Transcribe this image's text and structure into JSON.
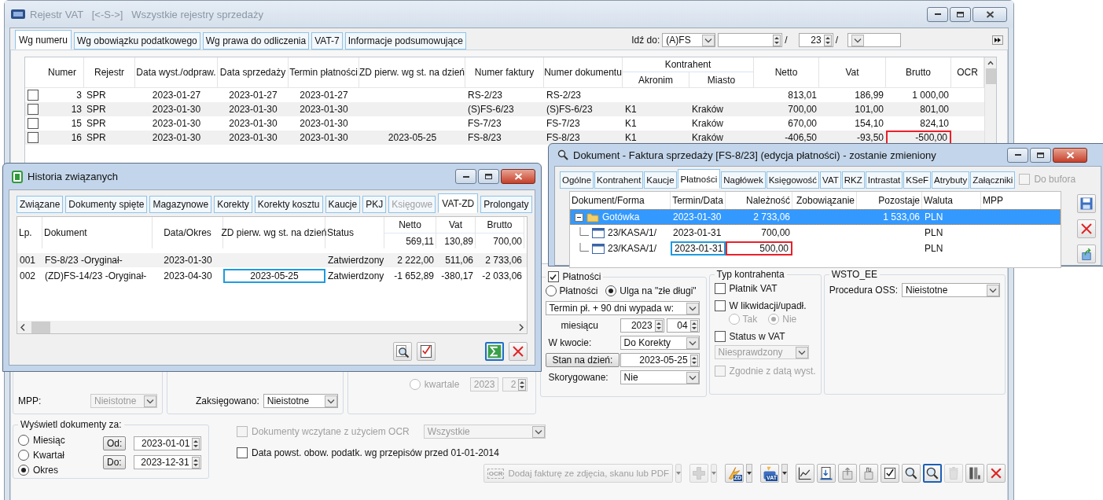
{
  "main_window": {
    "active": false,
    "title": "Rejestr VAT   [<-S->]   Wszystkie rejestry sprzedaży",
    "tabs": [
      {
        "label": "Wg numeru",
        "selected": true
      },
      {
        "label": "Wg obowiązku podatkowego",
        "selected": false
      },
      {
        "label": "Wg prawa do odliczenia",
        "selected": false
      },
      {
        "label": "VAT-7",
        "selected": false
      },
      {
        "label": "Informacje podsumowujące",
        "selected": false
      }
    ],
    "goto": {
      "label": "Idź do:",
      "series": "(A)FS",
      "separators": [
        "/",
        "/"
      ],
      "year": "23"
    },
    "table": {
      "columns": [
        "Numer",
        "Rejestr",
        "Data wyst./odpraw.",
        "Data sprzedaży",
        "Termin płatności",
        "ZD pierw. wg st. na dzień",
        "Numer faktury",
        "Numer dokumentu",
        "Akronim",
        "Miasto",
        "Netto",
        "Vat",
        "Brutto",
        "OCR"
      ],
      "group": "Kontrahent",
      "rows": [
        {
          "checked": false,
          "cells": [
            "3",
            "SPR",
            "2023-01-27",
            "2023-01-27",
            "2023-01-27",
            null,
            "RS-2/23",
            "RS-2/23",
            null,
            null,
            "813,01",
            "186,99",
            "1 000,00",
            null
          ]
        },
        {
          "checked": false,
          "cells": [
            "13",
            "SPR",
            "2023-01-30",
            "2023-01-30",
            "2023-01-30",
            null,
            "(S)FS-6/23",
            "(S)FS-6/23",
            "K1",
            "Kraków",
            "700,00",
            "101,00",
            "801,00",
            null
          ]
        },
        {
          "checked": false,
          "cells": [
            "15",
            "SPR",
            "2023-01-30",
            "2023-01-30",
            "2023-01-30",
            null,
            "FS-7/23",
            "FS-7/23",
            "K1",
            "Kraków",
            "670,00",
            "154,10",
            "824,10",
            null
          ]
        },
        {
          "checked": false,
          "cells": [
            "16",
            "SPR",
            "2023-01-30",
            "2023-01-30",
            "2023-01-30",
            "2023-05-25",
            "FS-8/23",
            "FS-8/23",
            "K1",
            "Kraków",
            "-406,50",
            "-93,50",
            {
              "text": "-500,00",
              "color": "#e8202a"
            },
            null
          ]
        }
      ]
    },
    "mpp": {
      "label": "MPP:",
      "value": "Nieistotne",
      "disabled": true
    },
    "booked": {
      "label": "Zaksięgowano:",
      "value": "Nieistotne"
    },
    "quarter": {
      "label": "kwartale",
      "selected": false,
      "year": "2023",
      "quarter": "2"
    },
    "payments": {
      "title": "Płatności",
      "checked": true,
      "modes": [
        {
          "label": "Płatności",
          "selected": false
        },
        {
          "label": "Ulga na \"złe długi\"",
          "selected": true
        }
      ],
      "term": "Termin pł. + 90 dni wypada w:",
      "month_label": "miesiącu",
      "year": "2023",
      "month": "04",
      "amount_label": "W kwocie:",
      "amount": "Do Korekty",
      "state_button": "Stan na dzień:",
      "state_date": "2023-05-25",
      "corrected_label": "Skorygowane:",
      "corrected": "Nie"
    },
    "contractor_type": {
      "title": "Typ kontrahenta",
      "vat_payer": {
        "label": "Płatnik VAT",
        "checked": false
      },
      "liquidation": {
        "label": "W likwidacji/upadł.",
        "checked": false
      },
      "liquidation_options": [
        {
          "label": "Tak",
          "selected": false
        },
        {
          "label": "Nie",
          "selected": true
        }
      ],
      "vat_status": {
        "label": "Status w VAT",
        "checked": false
      },
      "vat_status_value": "Niesprawdzony",
      "date_match": {
        "label": "Zgodnie z datą wyst.",
        "checked": false,
        "disabled": true
      }
    },
    "wsto": {
      "title": "WSTO_EE",
      "label": "Procedura OSS:",
      "value": "Nieistotne"
    },
    "period": {
      "title": "Wyświetl dokumenty za:",
      "options": [
        {
          "label": "Miesiąc",
          "selected": false
        },
        {
          "label": "Kwartał",
          "selected": false
        },
        {
          "label": "Okres",
          "selected": true
        }
      ],
      "from_label": "Od:",
      "from": "2023-01-01",
      "to_label": "Do:",
      "to": "2023-12-31"
    },
    "ocr_filter": {
      "label": "Dokumenty wczytane z użyciem OCR",
      "checked": false,
      "disabled": true,
      "value": "Wszystkie"
    },
    "old_rules": {
      "label": "Data powst. obow. podatk. wg przepisów przed 01-01-2014",
      "checked": false
    },
    "toolbar": [
      {
        "kind": "ocr",
        "badge": "OCR",
        "label": "Dodaj fakturę ze zdjęcia, skanu lub PDF",
        "disabled": true,
        "dropdown": true
      },
      {
        "kind": "plus",
        "disabled": true,
        "dropdown": true
      },
      {
        "kind": "zd",
        "badge": "ZD",
        "disabled": false,
        "dropdown": true
      },
      {
        "kind": "vat",
        "badge": "VAT",
        "disabled": false,
        "dropdown": true
      },
      {
        "kind": "chart",
        "disabled": false
      },
      {
        "kind": "import",
        "disabled": false
      },
      {
        "kind": "export",
        "disabled": false
      },
      {
        "kind": "hand",
        "disabled": false
      },
      {
        "kind": "check",
        "disabled": false
      },
      {
        "kind": "search",
        "disabled": false
      },
      {
        "kind": "search_doc",
        "disabled": false,
        "focused": true
      },
      {
        "kind": "trash",
        "disabled": true
      },
      {
        "kind": "columns",
        "disabled": false
      },
      {
        "kind": "close",
        "disabled": false
      }
    ]
  },
  "history_window": {
    "active": true,
    "title": "Historia związanych",
    "tabs": [
      {
        "label": "Związane",
        "selected": false,
        "disabled": false
      },
      {
        "label": "Dokumenty spięte",
        "selected": false,
        "disabled": false
      },
      {
        "label": "Magazynowe",
        "selected": false,
        "disabled": false
      },
      {
        "label": "Korekty",
        "selected": false,
        "disabled": false
      },
      {
        "label": "Korekty kosztu",
        "selected": false,
        "disabled": false
      },
      {
        "label": "Kaucje",
        "selected": false,
        "disabled": false
      },
      {
        "label": "PKJ",
        "selected": false,
        "disabled": false
      },
      {
        "label": "Księgowe",
        "selected": false,
        "disabled": true
      },
      {
        "label": "VAT-ZD",
        "selected": true,
        "disabled": false
      },
      {
        "label": "Prolongaty",
        "selected": false,
        "disabled": false
      }
    ],
    "table": {
      "columns": [
        "Lp.",
        "Dokument",
        "Data/Okres",
        "ZD pierw. wg st. na dzień",
        "Status",
        "Netto",
        "Vat",
        "Brutto"
      ],
      "totals": [
        "569,11",
        "130,89",
        "700,00"
      ],
      "rows": [
        {
          "cells": [
            "001",
            "FS-8/23 -Oryginał-",
            "2023-01-30",
            null,
            "Zatwierdzony",
            "2 222,00",
            "511,06",
            "2 733,06"
          ]
        },
        {
          "cells": [
            "002",
            "(ZD)FS-14/23 -Oryginał-",
            "2023-04-30",
            {
              "text": "2023-05-25",
              "color": "#1e9be0"
            },
            "Zatwierdzony",
            "-1 652,89",
            "-380,17",
            "-2 033,06"
          ]
        }
      ]
    }
  },
  "document_window": {
    "active": true,
    "title": "Dokument - Faktura sprzedaży [FS-8/23] (edycja płatności) - zostanie zmieniony",
    "tabs": [
      {
        "label": "Ogólne",
        "selected": false
      },
      {
        "label": "Kontrahent",
        "selected": false
      },
      {
        "label": "Kaucje",
        "selected": false
      },
      {
        "label": "Płatności",
        "selected": true
      },
      {
        "label": "Nagłówek",
        "selected": false
      },
      {
        "label": "Księgowość",
        "selected": false
      },
      {
        "label": "VAT",
        "selected": false
      },
      {
        "label": "RKZ",
        "selected": false
      },
      {
        "label": "Intrastat",
        "selected": false
      },
      {
        "label": "KSeF",
        "selected": false
      },
      {
        "label": "Atrybuty",
        "selected": false
      },
      {
        "label": "Załączniki",
        "selected": false
      }
    ],
    "to_buffer": {
      "label": "Do bufora",
      "checked": false,
      "disabled": true
    },
    "tree": {
      "columns": [
        "Dokument/Forma",
        "Termin/Data",
        "Należność",
        "Zobowiązanie",
        "Pozostaje",
        "Waluta",
        "MPP"
      ],
      "rows": [
        {
          "expanded": true,
          "selected": true,
          "cells": [
            "Gotówka",
            "2023-01-30",
            "2 733,06",
            null,
            "1 533,06",
            "PLN",
            null
          ],
          "children": [
            {
              "selected": false,
              "cells": [
                "23/KASA/1/",
                "2023-01-31",
                "700,00",
                null,
                null,
                "PLN",
                null
              ]
            },
            {
              "selected": false,
              "cells": [
                "23/KASA/1/",
                {
                  "text": "2023-01-31",
                  "color": "#1e9be0"
                },
                {
                  "text": "500,00",
                  "color": "#e8202a"
                },
                null,
                null,
                "PLN",
                null
              ]
            }
          ]
        }
      ]
    }
  }
}
